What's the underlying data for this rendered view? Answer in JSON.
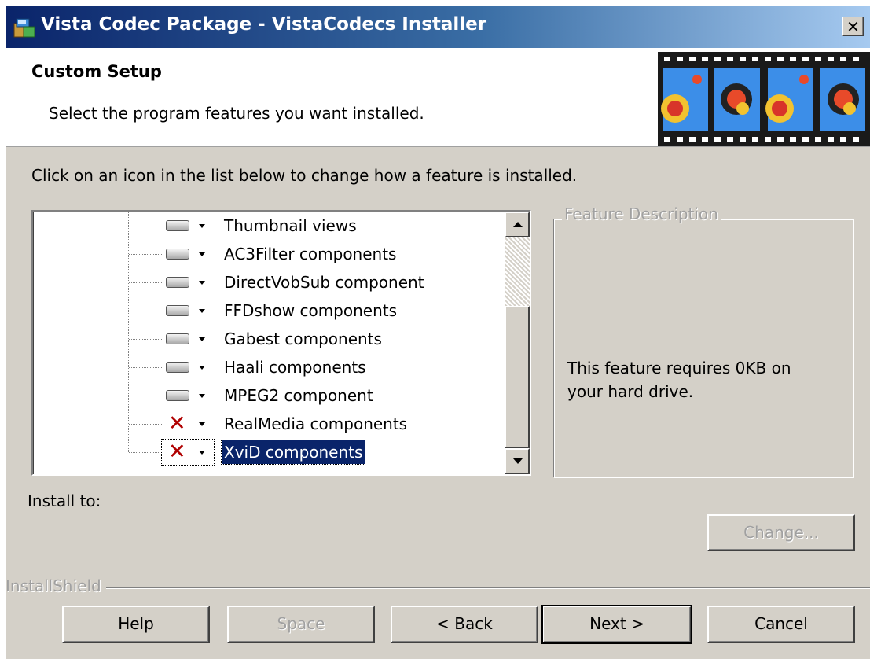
{
  "window": {
    "title": "Vista Codec Package - VistaCodecs Installer",
    "close_glyph": "✕",
    "icon": "installer-package-icon"
  },
  "header": {
    "title": "Custom Setup",
    "subtitle": "Select the program features you want installed.",
    "banner_icon": "film-strip-balloons-banner"
  },
  "instruction": "Click on an icon in the list below to change how a feature is installed.",
  "features": [
    {
      "label": "Thumbnail views",
      "state": "install",
      "icon": "hard-drive-icon"
    },
    {
      "label": "AC3Filter components",
      "state": "install",
      "icon": "hard-drive-icon"
    },
    {
      "label": "DirectVobSub component",
      "state": "install",
      "icon": "hard-drive-icon"
    },
    {
      "label": "FFDshow components",
      "state": "install",
      "icon": "hard-drive-icon"
    },
    {
      "label": "Gabest components",
      "state": "install",
      "icon": "hard-drive-icon"
    },
    {
      "label": "Haali components",
      "state": "install",
      "icon": "hard-drive-icon"
    },
    {
      "label": "MPEG2 component",
      "state": "install",
      "icon": "hard-drive-icon"
    },
    {
      "label": "RealMedia components",
      "state": "not-installed",
      "icon": "red-x-icon"
    },
    {
      "label": "XviD components",
      "state": "not-installed",
      "icon": "red-x-icon",
      "selected": true
    }
  ],
  "feature_description": {
    "legend": "Feature Description",
    "text": "This feature requires 0KB on your hard drive."
  },
  "install_to_label": "Install to:",
  "installshield_label": "InstallShield",
  "buttons": {
    "change": "Change...",
    "help": "Help",
    "space": "Space",
    "back": "< Back",
    "next": "Next >",
    "cancel": "Cancel"
  },
  "colors": {
    "titlebar_start": "#0a246a",
    "titlebar_end": "#a6caf0",
    "dialog_face": "#d4d0c8",
    "selection": "#0a246a",
    "not_installed_x": "#b00000"
  }
}
